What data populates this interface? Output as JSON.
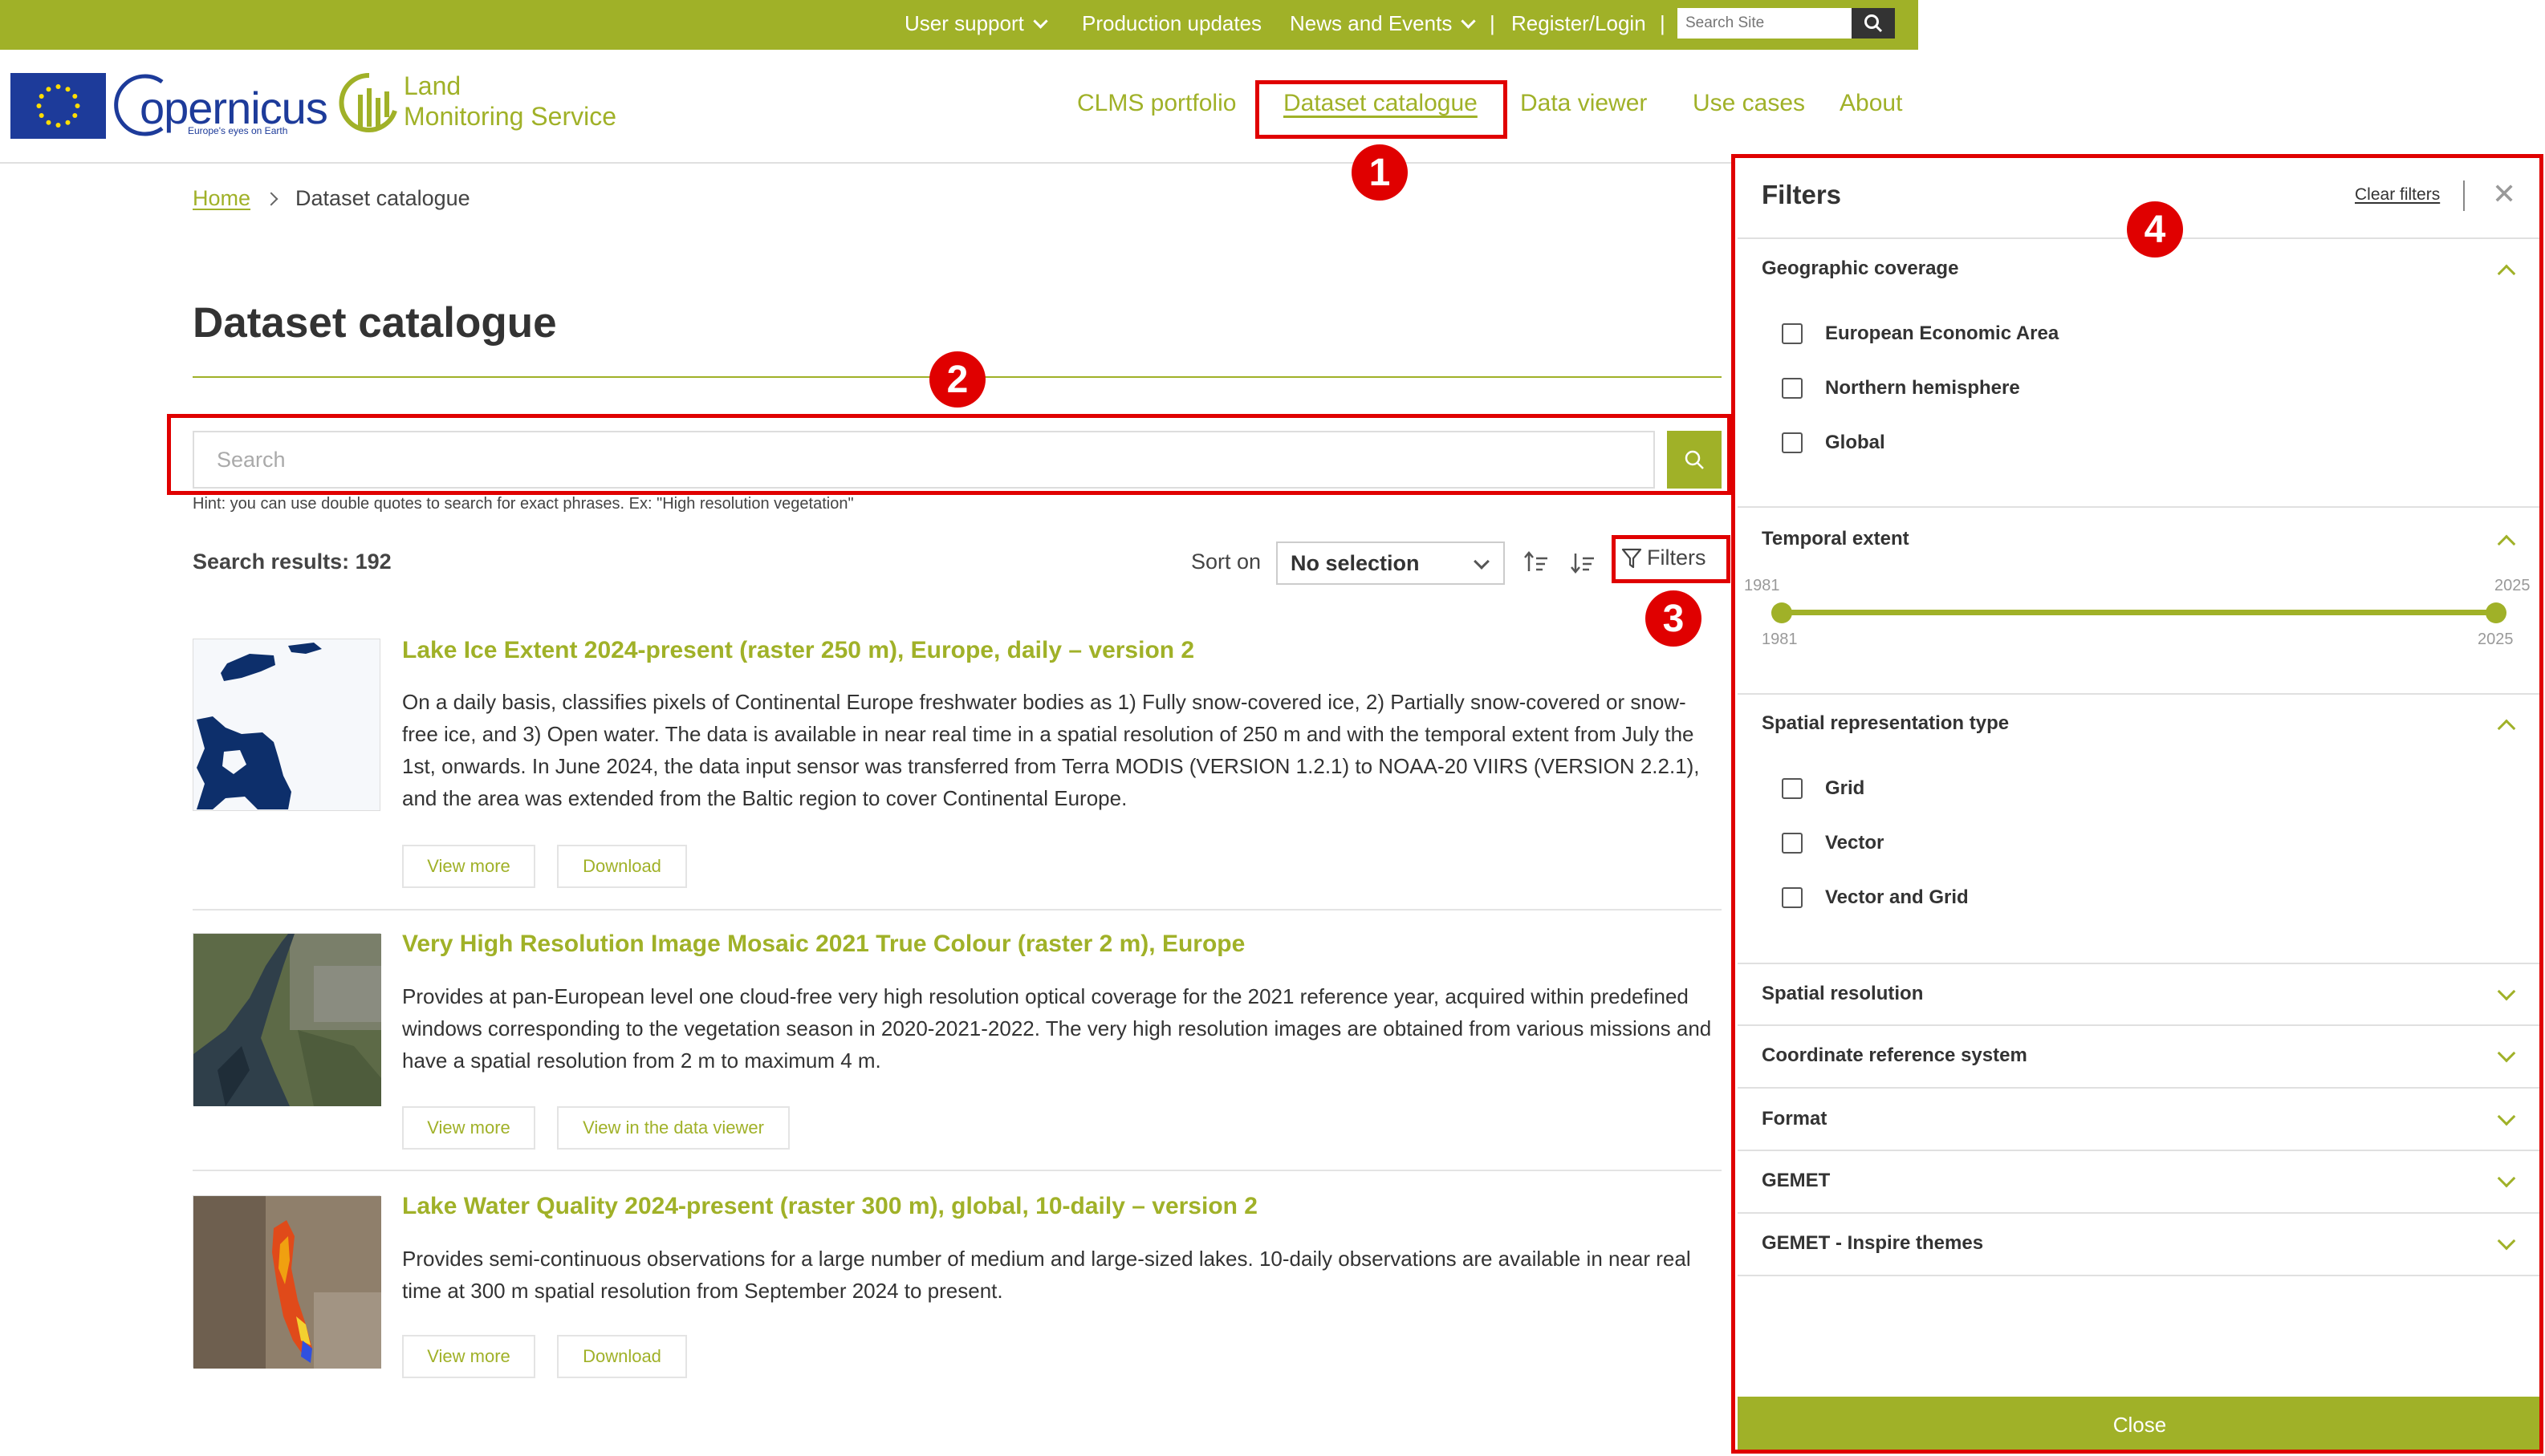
{
  "topbar": {
    "links": [
      "User support",
      "Production updates",
      "News and Events",
      "Register/Login"
    ],
    "search_placeholder": "Search Site"
  },
  "header": {
    "copernicus_logo": "opernicus",
    "copernicus_tagline": "Europe's eyes on Earth",
    "lms_line1": "Land",
    "lms_line2": "Monitoring Service",
    "nav": [
      "CLMS portfolio",
      "Dataset catalogue",
      "Data viewer",
      "Use cases",
      "About"
    ]
  },
  "annotations": [
    "1",
    "2",
    "3",
    "4"
  ],
  "breadcrumb": {
    "home": "Home",
    "current": "Dataset catalogue"
  },
  "page": {
    "title": "Dataset catalogue",
    "search_placeholder": "Search",
    "hint": "Hint: you can use double quotes to search for exact phrases. Ex: \"High resolution vegetation\"",
    "results_count": "Search results: 192",
    "sort_label": "Sort on",
    "sort_value": "No selection",
    "filters_label": "Filters"
  },
  "results": [
    {
      "title": "Lake Ice Extent 2024-present (raster 250 m), Europe, daily – version 2",
      "desc": "On a daily basis, classifies pixels of Continental Europe freshwater bodies as 1) Fully snow-covered ice, 2) Partially snow-covered or snow-free ice, and 3) Open water. The data is available in near real time in a spatial resolution of 250 m and with the temporal extent from July the 1st, onwards. In June 2024, the data input sensor was transferred from Terra MODIS (VERSION 1.2.1) to NOAA-20 VIIRS (VERSION 2.2.1), and the area was extended from the Baltic region to cover Continental Europe.",
      "btn1": "View more",
      "btn2": "Download"
    },
    {
      "title": "Very High Resolution Image Mosaic 2021 True Colour (raster 2 m), Europe",
      "desc": "Provides at pan-European level one cloud-free very high resolution optical coverage for the 2021 reference year, acquired within predefined windows corresponding to the vegetation season in 2020-2021-2022. The very high resolution images are obtained from various missions and have a spatial resolution from 2 m to maximum 4 m.",
      "btn1": "View more",
      "btn2": "View in the data viewer"
    },
    {
      "title": "Lake Water Quality 2024-present (raster 300 m), global, 10-daily – version 2",
      "desc": "Provides semi-continuous observations for a large number of medium and large-sized lakes. 10-daily observations are available in near real time at 300 m spatial resolution from September 2024 to present.",
      "btn1": "View more",
      "btn2": "Download"
    }
  ],
  "filters": {
    "title": "Filters",
    "clear": "Clear filters",
    "close_x": "✕",
    "geographic": {
      "title": "Geographic coverage",
      "options": [
        "European Economic Area",
        "Northern hemisphere",
        "Global"
      ]
    },
    "temporal": {
      "title": "Temporal extent",
      "min": "1981",
      "max": "2025",
      "low": "1981",
      "high": "2025"
    },
    "spatial_type": {
      "title": "Spatial representation type",
      "options": [
        "Grid",
        "Vector",
        "Vector and Grid"
      ]
    },
    "collapsed": [
      "Spatial resolution",
      "Coordinate reference system",
      "Format",
      "GEMET",
      "GEMET - Inspire themes"
    ],
    "close_button": "Close"
  },
  "colors": {
    "brand": "#a0b128",
    "annotation": "#e00000",
    "eu_blue": "#1d3b9a"
  }
}
